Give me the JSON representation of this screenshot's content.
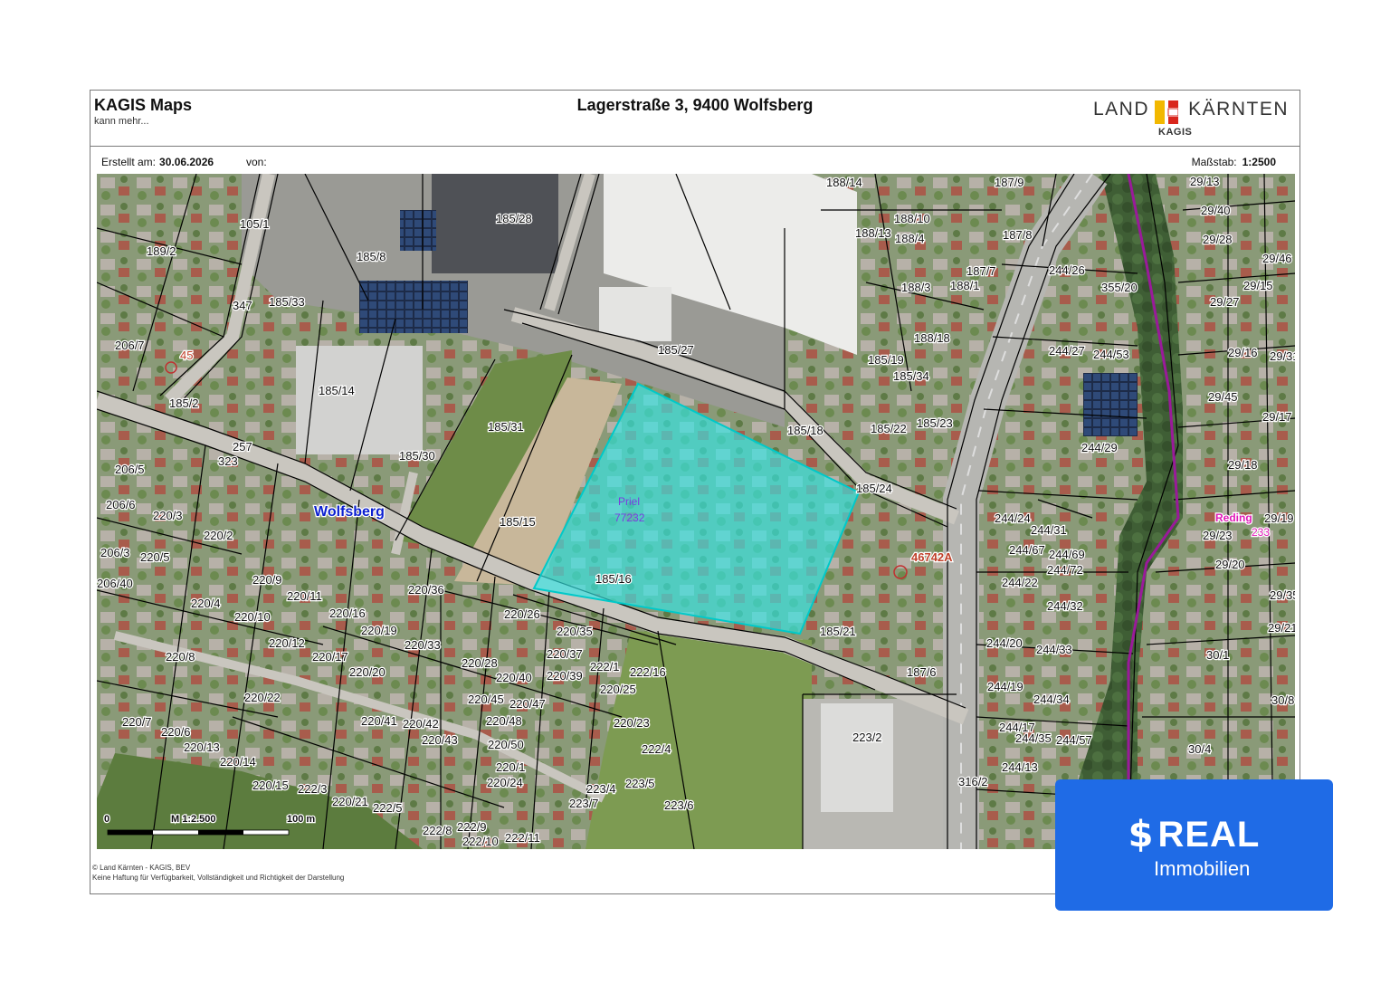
{
  "header": {
    "brand": "KAGIS Maps",
    "tagline": "kann mehr...",
    "address": "Lagerstraße 3, 9400 Wolfsberg",
    "logo_left": "LAND",
    "logo_right": "KÄRNTEN",
    "logo_sub": "KAGIS"
  },
  "meta": {
    "created_label": "Erstellt am:",
    "created_date": "30.06.2026",
    "by_label": "von:",
    "scale_label": "Maßstab:",
    "scale_value": "1:2500"
  },
  "map": {
    "place_name": "Wolfsberg",
    "parcel_name": "Priel",
    "parcel_number": "77232",
    "locality": "Reding",
    "locality_number": "233",
    "road_45": "45",
    "road_46742": "46742A",
    "scalebar": {
      "zero": "0",
      "mid": "M 1:2.500",
      "end": "100 m"
    },
    "colors": {
      "highlight": "#33e6e6",
      "boundary": "#000000",
      "river": "#9a1a9a",
      "place": "#0b1fd0"
    },
    "parcels": [
      {
        "id": "p1",
        "label": "185/28"
      },
      {
        "id": "p2",
        "label": "105/1"
      },
      {
        "id": "p3",
        "label": "189/2"
      },
      {
        "id": "p4",
        "label": "185/8"
      },
      {
        "id": "p5",
        "label": "347"
      },
      {
        "id": "p6",
        "label": "185/33"
      },
      {
        "id": "p7",
        "label": "206/7"
      },
      {
        "id": "p8",
        "label": "185/2"
      },
      {
        "id": "p9",
        "label": "185/14"
      },
      {
        "id": "p10",
        "label": "185/27"
      },
      {
        "id": "p11",
        "label": "185/31"
      },
      {
        "id": "p12",
        "label": "185/30"
      },
      {
        "id": "p13",
        "label": "257"
      },
      {
        "id": "p14",
        "label": "323"
      },
      {
        "id": "p15",
        "label": "206/5"
      },
      {
        "id": "p16",
        "label": "206/6"
      },
      {
        "id": "p17",
        "label": "220/3"
      },
      {
        "id": "p18",
        "label": "220/2"
      },
      {
        "id": "p19",
        "label": "206/3"
      },
      {
        "id": "p20",
        "label": "220/5"
      },
      {
        "id": "p21",
        "label": "206/40"
      },
      {
        "id": "p22",
        "label": "220/9"
      },
      {
        "id": "p23",
        "label": "220/11"
      },
      {
        "id": "p24",
        "label": "220/4"
      },
      {
        "id": "p25",
        "label": "220/16"
      },
      {
        "id": "p26",
        "label": "220/10"
      },
      {
        "id": "p27",
        "label": "220/19"
      },
      {
        "id": "p28",
        "label": "220/36"
      },
      {
        "id": "p29",
        "label": "220/26"
      },
      {
        "id": "p30",
        "label": "185/15"
      },
      {
        "id": "p31",
        "label": "185/16"
      },
      {
        "id": "p32",
        "label": "220/12"
      },
      {
        "id": "p33",
        "label": "220/17"
      },
      {
        "id": "p34",
        "label": "220/33"
      },
      {
        "id": "p35",
        "label": "220/35"
      },
      {
        "id": "p36",
        "label": "220/37"
      },
      {
        "id": "p37",
        "label": "220/8"
      },
      {
        "id": "p38",
        "label": "220/20"
      },
      {
        "id": "p39",
        "label": "220/28"
      },
      {
        "id": "p40",
        "label": "220/40"
      },
      {
        "id": "p41",
        "label": "220/39"
      },
      {
        "id": "p42",
        "label": "222/1"
      },
      {
        "id": "p43",
        "label": "222/16"
      },
      {
        "id": "p44",
        "label": "220/22"
      },
      {
        "id": "p45",
        "label": "220/45"
      },
      {
        "id": "p46",
        "label": "220/47"
      },
      {
        "id": "p47",
        "label": "220/25"
      },
      {
        "id": "p48",
        "label": "220/7"
      },
      {
        "id": "p49",
        "label": "220/6"
      },
      {
        "id": "p50",
        "label": "220/41"
      },
      {
        "id": "p51",
        "label": "220/42"
      },
      {
        "id": "p52",
        "label": "220/48"
      },
      {
        "id": "p53",
        "label": "220/23"
      },
      {
        "id": "p54",
        "label": "220/43"
      },
      {
        "id": "p55",
        "label": "220/50"
      },
      {
        "id": "p56",
        "label": "222/4"
      },
      {
        "id": "p57",
        "label": "220/13"
      },
      {
        "id": "p58",
        "label": "220/14"
      },
      {
        "id": "p59",
        "label": "220/1"
      },
      {
        "id": "p60",
        "label": "220/15"
      },
      {
        "id": "p61",
        "label": "222/3"
      },
      {
        "id": "p62",
        "label": "220/24"
      },
      {
        "id": "p63",
        "label": "223/4"
      },
      {
        "id": "p64",
        "label": "223/5"
      },
      {
        "id": "p65",
        "label": "220/21"
      },
      {
        "id": "p66",
        "label": "222/5"
      },
      {
        "id": "p67",
        "label": "223/7"
      },
      {
        "id": "p68",
        "label": "223/6"
      },
      {
        "id": "p69",
        "label": "222/8"
      },
      {
        "id": "p70",
        "label": "222/9"
      },
      {
        "id": "p71",
        "label": "222/10"
      },
      {
        "id": "p72",
        "label": "222/11"
      },
      {
        "id": "p73",
        "label": "188/14"
      },
      {
        "id": "p74",
        "label": "187/9"
      },
      {
        "id": "p75",
        "label": "188/10"
      },
      {
        "id": "p76",
        "label": "188/13"
      },
      {
        "id": "p77",
        "label": "188/4"
      },
      {
        "id": "p78",
        "label": "187/8"
      },
      {
        "id": "p79",
        "label": "187/7"
      },
      {
        "id": "p80",
        "label": "188/3"
      },
      {
        "id": "p81",
        "label": "188/1"
      },
      {
        "id": "p82",
        "label": "188/18"
      },
      {
        "id": "p83",
        "label": "185/19"
      },
      {
        "id": "p84",
        "label": "185/34"
      },
      {
        "id": "p85",
        "label": "185/18"
      },
      {
        "id": "p86",
        "label": "185/22"
      },
      {
        "id": "p87",
        "label": "185/23"
      },
      {
        "id": "p88",
        "label": "185/24"
      },
      {
        "id": "p89",
        "label": "185/21"
      },
      {
        "id": "p90",
        "label": "187/6"
      },
      {
        "id": "p91",
        "label": "223/2"
      },
      {
        "id": "p92",
        "label": "244/26"
      },
      {
        "id": "p93",
        "label": "355/20"
      },
      {
        "id": "p94",
        "label": "244/27"
      },
      {
        "id": "p95",
        "label": "244/53"
      },
      {
        "id": "p96",
        "label": "244/29"
      },
      {
        "id": "p97",
        "label": "244/24"
      },
      {
        "id": "p98",
        "label": "244/31"
      },
      {
        "id": "p99",
        "label": "244/67"
      },
      {
        "id": "p100",
        "label": "244/69"
      },
      {
        "id": "p101",
        "label": "244/72"
      },
      {
        "id": "p102",
        "label": "244/22"
      },
      {
        "id": "p103",
        "label": "244/32"
      },
      {
        "id": "p104",
        "label": "244/20"
      },
      {
        "id": "p105",
        "label": "244/33"
      },
      {
        "id": "p106",
        "label": "244/19"
      },
      {
        "id": "p107",
        "label": "244/34"
      },
      {
        "id": "p108",
        "label": "244/17"
      },
      {
        "id": "p109",
        "label": "244/35"
      },
      {
        "id": "p110",
        "label": "244/57"
      },
      {
        "id": "p111",
        "label": "244/13"
      },
      {
        "id": "p112",
        "label": "316/2"
      },
      {
        "id": "p113",
        "label": "29/13"
      },
      {
        "id": "p114",
        "label": "29/40"
      },
      {
        "id": "p115",
        "label": "29/28"
      },
      {
        "id": "p116",
        "label": "29/46"
      },
      {
        "id": "p117",
        "label": "29/27"
      },
      {
        "id": "p118",
        "label": "29/15"
      },
      {
        "id": "p119",
        "label": "29/16"
      },
      {
        "id": "p120",
        "label": "29/31"
      },
      {
        "id": "p121",
        "label": "29/45"
      },
      {
        "id": "p122",
        "label": "29/17"
      },
      {
        "id": "p123",
        "label": "29/18"
      },
      {
        "id": "p124",
        "label": "29/19"
      },
      {
        "id": "p125",
        "label": "29/23"
      },
      {
        "id": "p126",
        "label": "29/20"
      },
      {
        "id": "p127",
        "label": "29/35"
      },
      {
        "id": "p128",
        "label": "29/21"
      },
      {
        "id": "p129",
        "label": "30/1"
      },
      {
        "id": "p130",
        "label": "30/8"
      },
      {
        "id": "p131",
        "label": "30/4"
      }
    ]
  },
  "footer": {
    "copyright": "© Land Kärnten - KAGIS, BEV",
    "disclaimer": "Keine Haftung für Verfügbarkeit, Vollständigkeit und Richtigkeit der Darstellung"
  },
  "badge": {
    "symbol": "$",
    "word": "REAL",
    "sub": "Immobilien"
  }
}
